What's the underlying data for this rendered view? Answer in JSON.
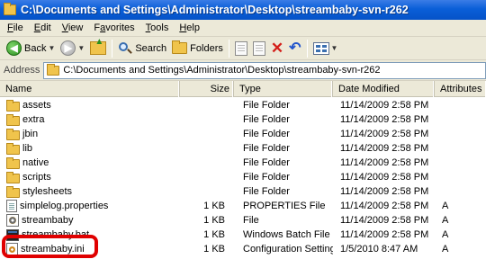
{
  "window": {
    "title": "C:\\Documents and Settings\\Administrator\\Desktop\\streambaby-svn-r262"
  },
  "menu": {
    "items": [
      {
        "label": "File",
        "key": "F",
        "rest": "ile"
      },
      {
        "label": "Edit",
        "key": "E",
        "rest": "dit"
      },
      {
        "label": "View",
        "key": "V",
        "rest": "iew"
      },
      {
        "label": "Favorites",
        "key": "a",
        "pre": "F",
        "rest": "vorites"
      },
      {
        "label": "Tools",
        "key": "T",
        "rest": "ools"
      },
      {
        "label": "Help",
        "key": "H",
        "rest": "elp"
      }
    ]
  },
  "toolbar": {
    "back_label": "Back",
    "search_label": "Search",
    "folders_label": "Folders"
  },
  "address": {
    "label": "Address",
    "path": "C:\\Documents and Settings\\Administrator\\Desktop\\streambaby-svn-r262"
  },
  "columns": {
    "name": "Name",
    "size": "Size",
    "type": "Type",
    "date": "Date Modified",
    "attributes": "Attributes"
  },
  "files": [
    {
      "name": "assets",
      "size": "",
      "type": "File Folder",
      "date": "11/14/2009 2:58 PM",
      "attr": "",
      "icon": "folder-icon"
    },
    {
      "name": "extra",
      "size": "",
      "type": "File Folder",
      "date": "11/14/2009 2:58 PM",
      "attr": "",
      "icon": "folder-icon"
    },
    {
      "name": "jbin",
      "size": "",
      "type": "File Folder",
      "date": "11/14/2009 2:58 PM",
      "attr": "",
      "icon": "folder-icon"
    },
    {
      "name": "lib",
      "size": "",
      "type": "File Folder",
      "date": "11/14/2009 2:58 PM",
      "attr": "",
      "icon": "folder-icon"
    },
    {
      "name": "native",
      "size": "",
      "type": "File Folder",
      "date": "11/14/2009 2:58 PM",
      "attr": "",
      "icon": "folder-icon"
    },
    {
      "name": "scripts",
      "size": "",
      "type": "File Folder",
      "date": "11/14/2009 2:58 PM",
      "attr": "",
      "icon": "folder-icon"
    },
    {
      "name": "stylesheets",
      "size": "",
      "type": "File Folder",
      "date": "11/14/2009 2:58 PM",
      "attr": "",
      "icon": "folder-icon"
    },
    {
      "name": "simplelog.properties",
      "size": "1 KB",
      "type": "PROPERTIES File",
      "date": "11/14/2009 2:58 PM",
      "attr": "A",
      "icon": "document-icon"
    },
    {
      "name": "streambaby",
      "size": "1 KB",
      "type": "File",
      "date": "11/14/2009 2:58 PM",
      "attr": "A",
      "icon": "settings-file-icon"
    },
    {
      "name": "streambaby.bat",
      "size": "1 KB",
      "type": "Windows Batch File",
      "date": "11/14/2009 2:58 PM",
      "attr": "A",
      "icon": "batch-file-icon"
    },
    {
      "name": "streambaby.ini",
      "size": "1 KB",
      "type": "Configuration Settings",
      "date": "1/5/2010 8:47 AM",
      "attr": "A",
      "icon": "ini-file-icon"
    }
  ],
  "colors": {
    "titlebar": "#0553c8",
    "highlight": "#e00000",
    "chrome": "#ece9d8"
  }
}
